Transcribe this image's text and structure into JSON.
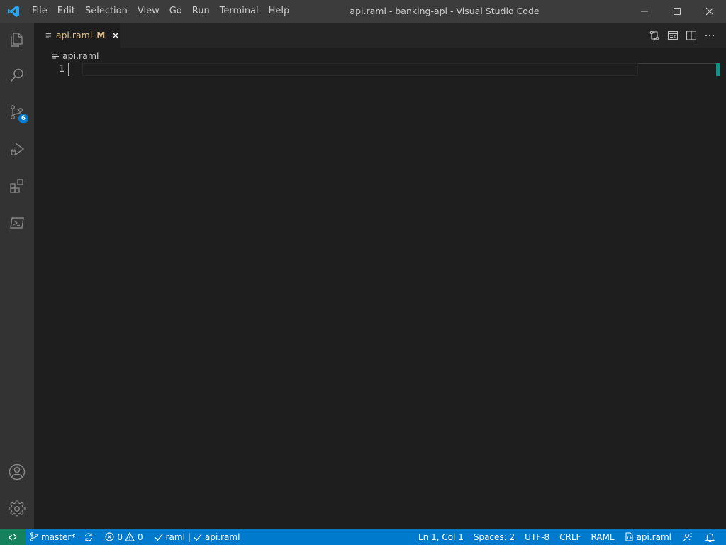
{
  "window": {
    "title": "api.raml - banking-api - Visual Studio Code"
  },
  "menu": {
    "items": [
      "File",
      "Edit",
      "Selection",
      "View",
      "Go",
      "Run",
      "Terminal",
      "Help"
    ]
  },
  "activity_bar": {
    "items": [
      {
        "name": "explorer",
        "icon": "files-icon"
      },
      {
        "name": "search",
        "icon": "search-icon"
      },
      {
        "name": "source-control",
        "icon": "source-control-icon",
        "badge": "6"
      },
      {
        "name": "run-debug",
        "icon": "run-debug-icon"
      },
      {
        "name": "extensions",
        "icon": "extensions-icon"
      },
      {
        "name": "powershell",
        "icon": "terminal-icon"
      }
    ],
    "bottom": [
      {
        "name": "accounts",
        "icon": "account-icon"
      },
      {
        "name": "manage",
        "icon": "gear-icon"
      }
    ]
  },
  "tabs": [
    {
      "label": "api.raml",
      "modified": "M",
      "active": true
    }
  ],
  "breadcrumb": {
    "file": "api.raml"
  },
  "editor": {
    "lines": [
      "1"
    ]
  },
  "status": {
    "branch": "master*",
    "errors": "0",
    "warnings": "0",
    "language_check": "raml",
    "separator": "|",
    "file_check": "api.raml",
    "position": "Ln 1, Col 1",
    "spaces": "Spaces: 2",
    "encoding": "UTF-8",
    "eol": "CRLF",
    "language": "RAML",
    "file": "api.raml"
  },
  "colors": {
    "accent": "#007acc",
    "remote": "#16825d",
    "modified": "#e2c08d"
  }
}
